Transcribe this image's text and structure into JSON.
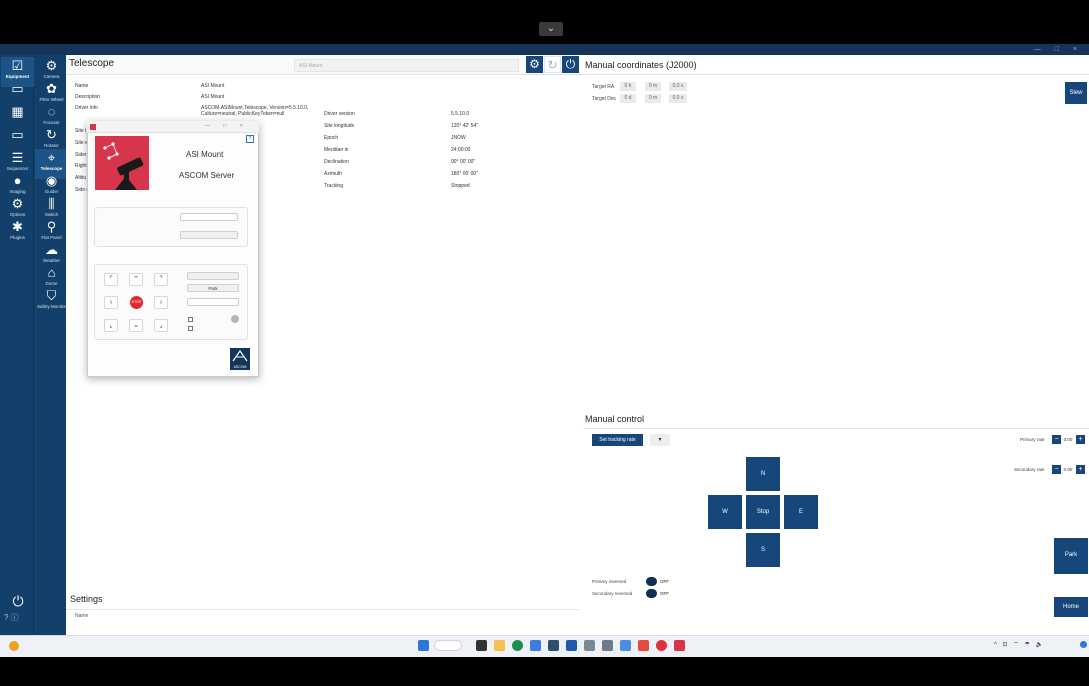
{
  "remote": {
    "collapse_icon": "chevron-down-icon",
    "collapse_glyph": "⌄"
  },
  "window": {
    "title": "",
    "controls": [
      "—",
      "□",
      "×"
    ]
  },
  "nav": {
    "col1": [
      {
        "label": "Equipment",
        "icon": "equipment-icon",
        "glyph": "☑",
        "active": true
      },
      {
        "label": "",
        "icon": "skyatlas-icon",
        "glyph": "▭"
      },
      {
        "label": "",
        "icon": "framing-icon",
        "glyph": "▦"
      },
      {
        "label": "",
        "icon": "flatwizard-icon",
        "glyph": "▭"
      },
      {
        "label": "Sequencer",
        "icon": "sequencer-icon",
        "glyph": "☰"
      },
      {
        "label": "Imaging",
        "icon": "imaging-icon",
        "glyph": "●"
      },
      {
        "label": "Options",
        "icon": "options-icon",
        "glyph": "⚙"
      },
      {
        "label": "Plugins",
        "icon": "plugins-icon",
        "glyph": "✱"
      }
    ],
    "col2": [
      {
        "label": "Camera",
        "icon": "camera-icon",
        "glyph": "⚙"
      },
      {
        "label": "Filter Wheel",
        "icon": "filterwheel-icon",
        "glyph": "✿"
      },
      {
        "label": "Focuser",
        "icon": "focuser-icon",
        "glyph": "◌"
      },
      {
        "label": "Rotator",
        "icon": "rotator-icon",
        "glyph": "↻"
      },
      {
        "label": "Telescope",
        "icon": "telescope-icon",
        "glyph": "⌖",
        "active": true
      },
      {
        "label": "Guider",
        "icon": "guider-icon",
        "glyph": "◉"
      },
      {
        "label": "Switch",
        "icon": "switch-icon",
        "glyph": "⫼"
      },
      {
        "label": "Flat Panel",
        "icon": "flatpanel-icon",
        "glyph": "⚲"
      },
      {
        "label": "Weather",
        "icon": "weather-icon",
        "glyph": "☁"
      },
      {
        "label": "Dome",
        "icon": "dome-icon",
        "glyph": "⌂"
      },
      {
        "label": "Safety Monitor",
        "icon": "safety-icon",
        "glyph": "⛉"
      }
    ],
    "power_glyph": "⏻",
    "help_text": "? ⓘ"
  },
  "telescope": {
    "title": "Telescope",
    "device": "ASI Mount",
    "header_buttons": [
      {
        "name": "settings-button",
        "glyph": "⚙"
      },
      {
        "name": "refresh-button",
        "glyph": "↻"
      },
      {
        "name": "connect-button",
        "glyph": "⏻"
      }
    ],
    "info_left": [
      {
        "label": "Name",
        "value": "ASI Mount"
      },
      {
        "label": "Description",
        "value": "ASI Mount"
      },
      {
        "label": "Driver info",
        "value": "ASCOM.ASIMount.Telescope, Version=5.5.10.0, Culture=neutral, PublicKeyToken=null"
      }
    ],
    "info_right": [
      {
        "label": "Driver version",
        "value": "5.5.10.0"
      },
      {
        "label": "Site longitude",
        "value": "120° 42' 54\""
      },
      {
        "label": "Epoch",
        "value": "JNOW"
      },
      {
        "label": "Meridian in",
        "value": "24:00:00"
      },
      {
        "label": "Declination",
        "value": "90° 00' 00\""
      },
      {
        "label": "Azimuth",
        "value": "180° 00' 00\""
      },
      {
        "label": "Tracking",
        "value": "Stopped"
      }
    ],
    "hidden_labels": [
      "Site l",
      "Site e",
      "Sider",
      "Right",
      "Altitu",
      "Side o"
    ]
  },
  "manual_coords": {
    "title": "Manual coordinates (J2000)",
    "target_ra_label": "Target RA",
    "target_dec_label": "Target Dec",
    "ra": [
      "0 h",
      "0 m",
      "0.0 s"
    ],
    "dec": [
      "0 d",
      "0 m",
      "0.0 s"
    ],
    "slew_label": "Slew"
  },
  "manual_control": {
    "title": "Manual control",
    "set_tracking_rate": "Set tracking rate",
    "rate_dropdown": "▾",
    "primary_rate_label": "Primary rate",
    "primary_rate_value": "0.00",
    "secondary_rate_label": "Secondary rate",
    "secondary_rate_value": "0.00",
    "minus": "−",
    "plus": "+",
    "n": "N",
    "w": "W",
    "stop": "Stop",
    "e": "E",
    "s": "S",
    "park": "Park",
    "home": "Home",
    "primary_reversed_label": "Primary reversed",
    "secondary_reversed_label": "Secondary reversed",
    "primary_reversed_state": "OFF",
    "secondary_reversed_state": "OFF"
  },
  "settings": {
    "title": "Settings",
    "name_label": "Name"
  },
  "popup": {
    "title": "",
    "controls": [
      "—",
      "□",
      "×"
    ],
    "app_name": "ASI Mount",
    "app_sub": "ASCOM Server",
    "help": "?",
    "section_connect": "",
    "connected_prefix": "",
    "connected": "",
    "mode_label": "",
    "mode_value": "",
    "firmware_label": "",
    "firmware_value": "",
    "firmware_button": "",
    "section_action": "",
    "action_button": "",
    "park_button": "Park",
    "speed_value": "",
    "stop_label": "STOP",
    "check1": "",
    "check2": "",
    "arrows": {
      "nw": "⌜",
      "n": "⌃",
      "ne": "⌝",
      "w": "‹",
      "e": "›",
      "sw": "⌞",
      "s": "⌄",
      "se": "⌟"
    },
    "ascom_logo": "ASCOM"
  },
  "taskbar": {
    "weather_temp": "",
    "weather_desc": "",
    "search_label": "",
    "tray": "^ ⊡ ⌔ ☂ 🔈",
    "time": "",
    "date": ""
  }
}
